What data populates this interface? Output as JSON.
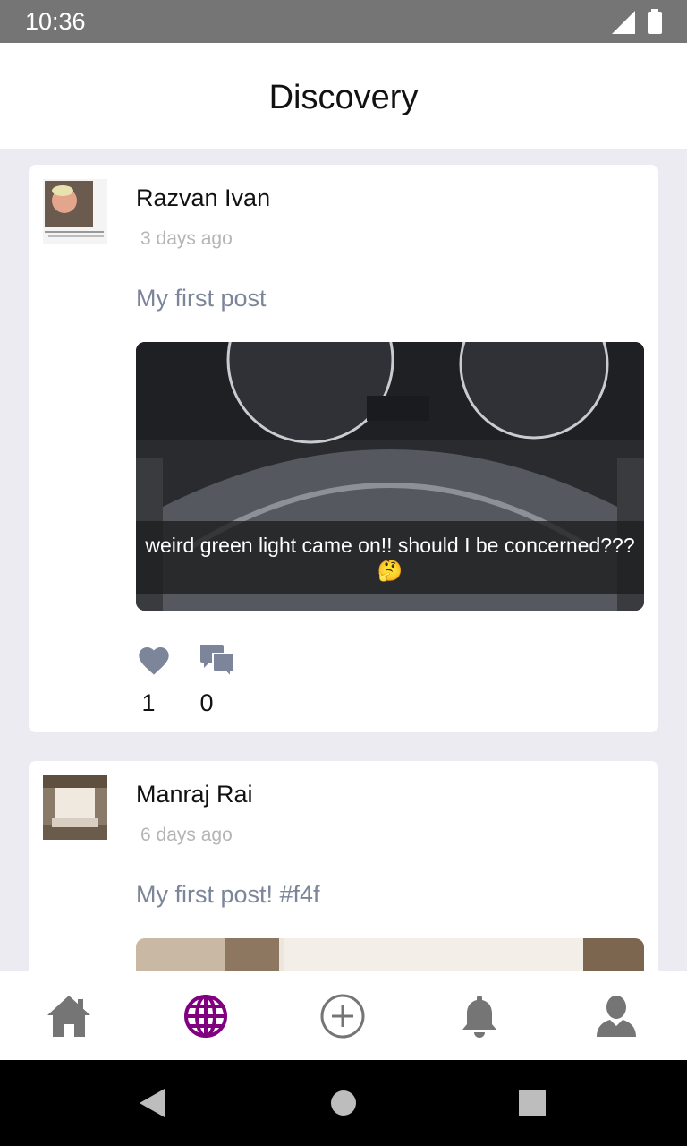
{
  "status_bar": {
    "time": "10:36"
  },
  "app_bar": {
    "title": "Discovery"
  },
  "posts": [
    {
      "author": "Razvan Ivan",
      "time_ago": "3 days ago",
      "text": "My first post",
      "image_caption": "weird green light came on!! should I be concerned??? 🤔",
      "likes": "1",
      "comments": "0"
    },
    {
      "author": "Manraj Rai",
      "time_ago": "6 days ago",
      "text": "My first post! #f4f"
    }
  ],
  "bottom_nav": {
    "items": [
      "home-icon",
      "globe-icon",
      "add-circle-icon",
      "bell-icon",
      "profile-icon"
    ],
    "active_index": 1
  },
  "colors": {
    "accent": "#800080",
    "icon_inactive": "#757575",
    "background": "#ecebf1",
    "post_text": "#7c8599"
  }
}
